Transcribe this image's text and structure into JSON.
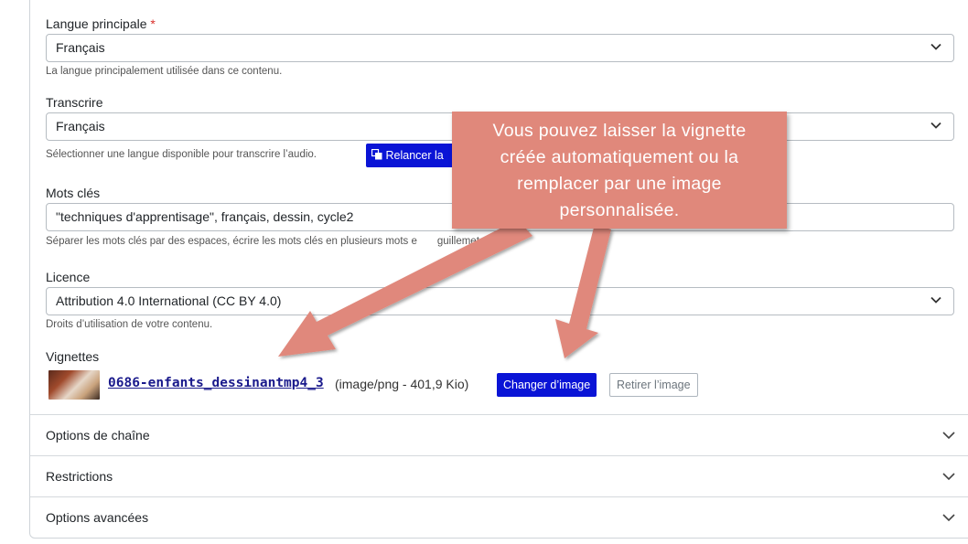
{
  "form": {
    "langue": {
      "label": "Langue principale",
      "required_mark": "*",
      "value": "Français",
      "help": "La langue principalement utilisée dans ce contenu."
    },
    "transcrire": {
      "label": "Transcrire",
      "value": "Français",
      "help": "Sélectionner une langue disponible pour transcrire l’audio.",
      "button_label": "Relancer la"
    },
    "mots_cles": {
      "label": "Mots clés",
      "value": "\"techniques d'apprentisage\", français, dessin, cycle2",
      "help": "Séparer les mots clés par des espaces, écrire les mots clés en plusieurs mots e",
      "help_tail": "guillemets."
    },
    "licence": {
      "label": "Licence",
      "value": "Attribution 4.0 International (CC BY 4.0)",
      "help": "Droits d’utilisation de votre contenu."
    },
    "vignettes": {
      "label": "Vignettes",
      "file_name": "0686-enfants_dessinantmp4_3",
      "file_meta": "(image/png - 401,9 Kio)",
      "change_label": "Changer d’image",
      "remove_label": "Retirer l’image"
    }
  },
  "sections": [
    {
      "title": "Options de chaîne"
    },
    {
      "title": "Restrictions"
    },
    {
      "title": "Options avancées"
    }
  ],
  "callout": {
    "line1": "Vous pouvez laisser la vignette",
    "line2": "créée automatiquement ou la",
    "line3": "remplacer par une image",
    "line4": "personnalisée."
  },
  "colors": {
    "primary_button": "#0a14d6",
    "callout": "#e0887b",
    "required": "#d9302c"
  },
  "icons": {
    "select": "chevron-down-icon",
    "transcribe_button": "transcribe-icon"
  }
}
